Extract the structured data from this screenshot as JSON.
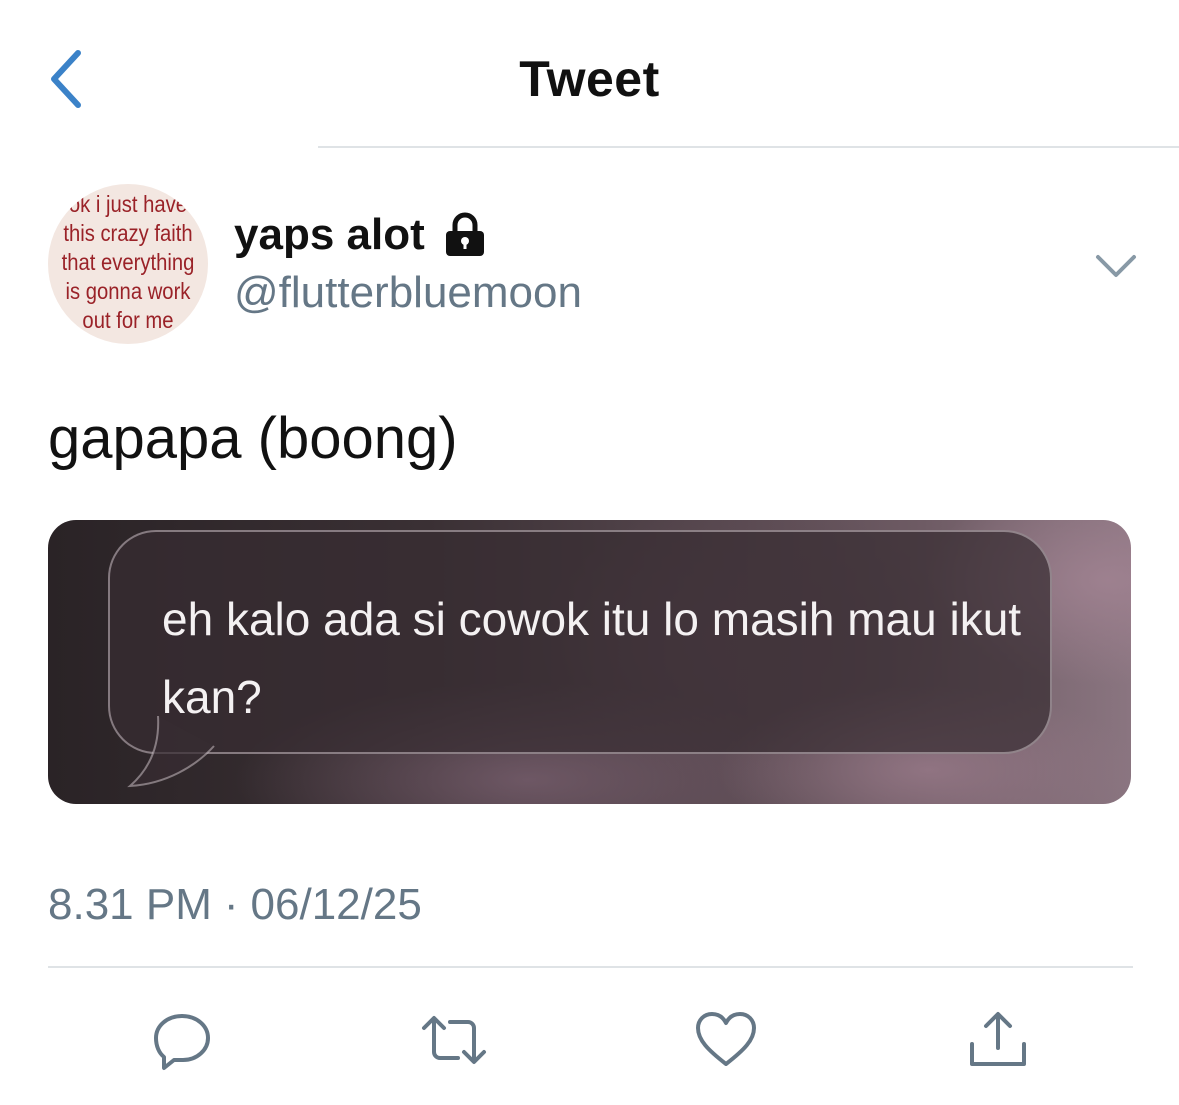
{
  "header": {
    "title": "Tweet"
  },
  "tweet": {
    "author": {
      "display_name": "yaps alot",
      "handle": "@flutterbluemoon",
      "avatar_text_lines": [
        "ok i just have",
        "this crazy faith",
        "that everything",
        "is gonna work",
        "out for me"
      ]
    },
    "text": "gapapa (boong)",
    "media": {
      "bubble_text": "eh kalo ada si cowok itu lo masih mau ikut kan?"
    },
    "time": "8.31 PM",
    "separator": "·",
    "date": "06/12/25"
  },
  "colors": {
    "accent": "#1da1f2",
    "back_arrow": "#3b82c8",
    "secondary_text": "#657786",
    "divider": "#dfe3e6",
    "avatar_text": "#9a2228"
  },
  "icons": {
    "back": "chevron-left-icon",
    "lock": "lock-icon",
    "more": "chevron-down-icon",
    "reply": "reply-icon",
    "retweet": "retweet-icon",
    "like": "heart-icon",
    "share": "share-icon"
  }
}
